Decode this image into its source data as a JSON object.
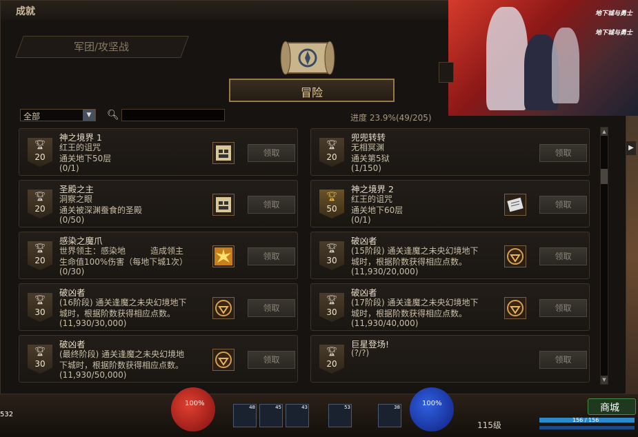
{
  "window": {
    "title": "成就"
  },
  "tabs": {
    "left_label": "军团/攻坚战",
    "main_label": "冒险"
  },
  "filter": {
    "selected": "全部",
    "arrow": "▼"
  },
  "search": {
    "placeholder": ""
  },
  "progress": {
    "label": "进度",
    "value": "23.9%(49/205)"
  },
  "claim_label": "领取",
  "achievements": [
    {
      "title": "神之境界 1",
      "lines": [
        "红王的诅咒",
        "通关地下50层",
        "(0/1)"
      ],
      "points": "20",
      "badge": "silver",
      "reward": "map-icon"
    },
    {
      "title": "兜兜转转",
      "lines": [
        "无相冥渊",
        "通关第5狱",
        "(1/150)"
      ],
      "points": "20",
      "badge": "silver",
      "reward": ""
    },
    {
      "title": "圣殿之主",
      "lines": [
        "洞察之眼",
        "通关被深渊蚕食的圣殿",
        "(0/50)"
      ],
      "points": "20",
      "badge": "silver",
      "reward": "map-icon"
    },
    {
      "title": "神之境界 2",
      "lines": [
        "红王的诅咒",
        "通关地下60层",
        "(0/1)"
      ],
      "points": "50",
      "badge": "gold",
      "reward": "scroll-icon"
    },
    {
      "title": "感染之魔爪",
      "lines": [
        "世界领主：感染地　　　造成领主",
        "生命值100%伤害（每地下城1次）",
        "(0/30)"
      ],
      "points": "20",
      "badge": "silver",
      "reward": "star-burst-icon"
    },
    {
      "title": "破凶者",
      "lines": [
        "(15阶段) 通关逢魔之未央幻境地下",
        "城时，根据阶数获得相应点数。",
        "(11,930/20,000)"
      ],
      "points": "30",
      "badge": "silver",
      "reward": "emblem-icon"
    },
    {
      "title": "破凶者",
      "lines": [
        "(16阶段) 通关逢魔之未央幻境地下",
        "城时，根据阶数获得相应点数。",
        "(11,930/30,000)"
      ],
      "points": "30",
      "badge": "silver",
      "reward": "emblem-icon"
    },
    {
      "title": "破凶者",
      "lines": [
        "(17阶段) 通关逢魔之未央幻境地下",
        "城时，根据阶数获得相应点数。",
        "(11,930/40,000)"
      ],
      "points": "30",
      "badge": "silver",
      "reward": "emblem-icon"
    },
    {
      "title": "破凶者",
      "lines": [
        "(最终阶段) 通关逢魔之未央幻境地",
        "下城时，根据阶数获得相应点数。",
        "(11,930/50,000)"
      ],
      "points": "30",
      "badge": "silver",
      "reward": "emblem-icon"
    },
    {
      "title": "巨星登场!",
      "lines": [
        "(?/?)",
        "",
        ""
      ],
      "points": "20",
      "badge": "silver",
      "reward": ""
    }
  ],
  "banner": {
    "logo_text": "地下城与勇士"
  },
  "hud": {
    "hp_orb": "100%",
    "mp_orb": "100%",
    "level": "115级",
    "hp_text": "156 / 156",
    "mall_label": "商城",
    "coin": "532",
    "skill_counts": [
      "48",
      "45",
      "43",
      "53",
      "38"
    ]
  }
}
